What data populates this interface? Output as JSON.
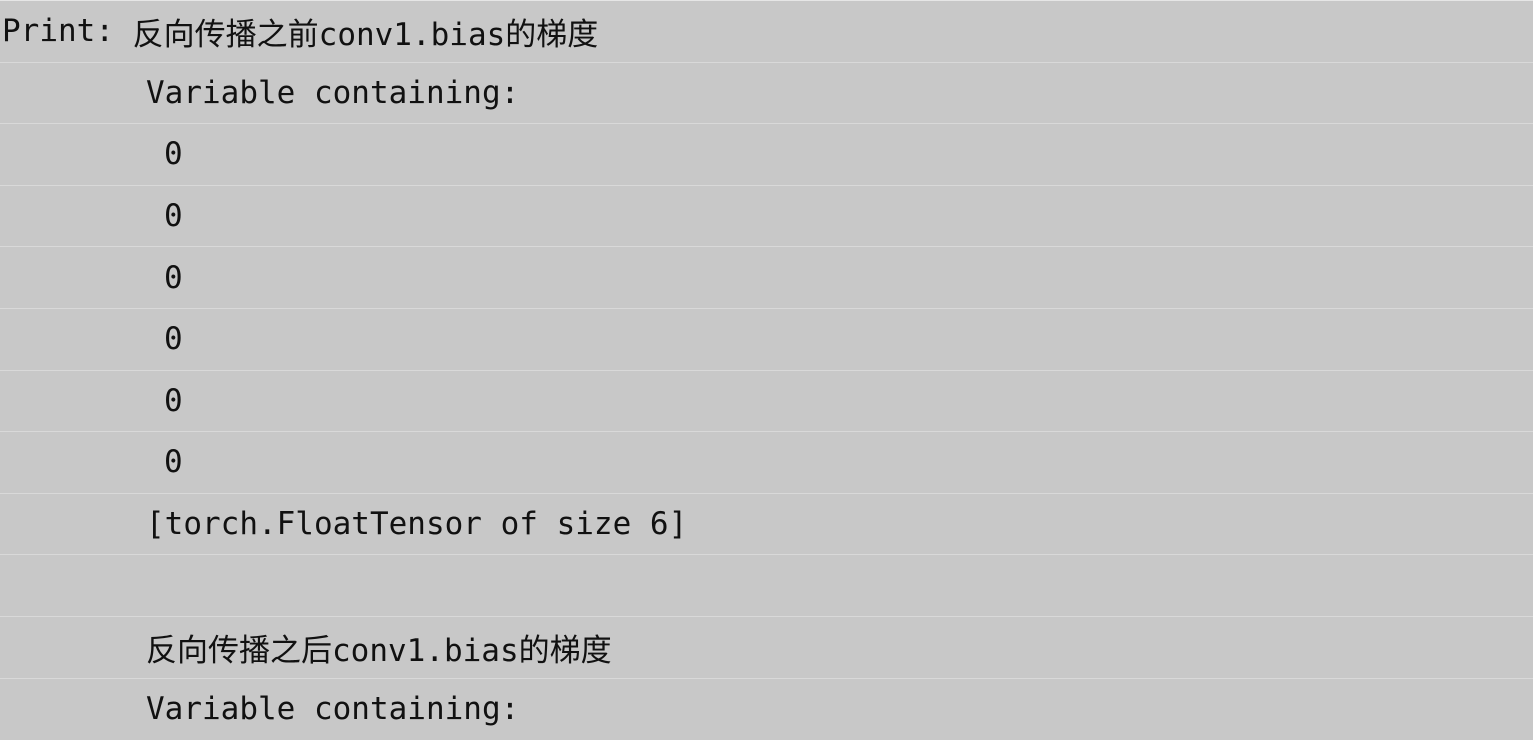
{
  "listing": {
    "prompt": "Print:",
    "before_title": "反向传播之前conv1.bias的梯度",
    "before_header": "Variable containing:",
    "before_values": [
      "0",
      "0",
      "0",
      "0",
      "0",
      "0"
    ],
    "before_footer": "[torch.FloatTensor of size 6]",
    "after_title": "反向传播之后conv1.bias的梯度",
    "after_header": "Variable containing:"
  }
}
